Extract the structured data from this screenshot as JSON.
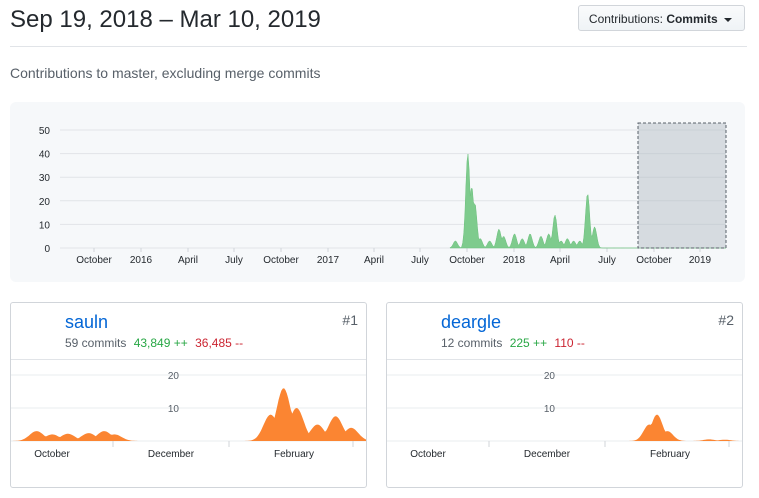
{
  "header": {
    "title": "Sep 19, 2018 – Mar 10, 2019",
    "select_prefix": "Contributions:",
    "select_value": "Commits"
  },
  "subtitle": "Contributions to master, excluding merge commits",
  "colors": {
    "main_fill": "#7ecb8d",
    "card_fill": "#fb8532",
    "link": "#0366d6",
    "added": "#28a745",
    "removed": "#cb2431"
  },
  "chart_data": [
    {
      "type": "area",
      "y_ticks": [
        "50",
        "40",
        "30",
        "20",
        "10",
        "0"
      ],
      "ylim": [
        0,
        50
      ],
      "x_tick_labels": [
        "October",
        "2016",
        "April",
        "July",
        "October",
        "2017",
        "April",
        "July",
        "October",
        "2018",
        "April",
        "July",
        "October",
        "2019"
      ],
      "series": [
        {
          "values": [
            [
              26.4,
              3
            ],
            [
              27.0,
              40
            ],
            [
              27.4,
              19
            ],
            [
              28.0,
              2
            ],
            [
              29.0,
              8
            ],
            [
              30.2,
              6
            ],
            [
              31.8,
              5
            ],
            [
              32.6,
              14
            ],
            [
              34.2,
              3
            ],
            [
              34.7,
              23
            ],
            [
              35.2,
              9
            ]
          ]
        }
      ],
      "selection": "Sep 19, 2018 – Mar 10, 2019"
    },
    {
      "type": "area",
      "y_ticks": [
        "20",
        "10"
      ],
      "x_tick_labels": [
        "October",
        "December",
        "February"
      ],
      "series": [
        {
          "values": [
            [
              0.3,
              3
            ],
            [
              0.9,
              2
            ],
            [
              1.6,
              3
            ],
            [
              5.0,
              16
            ],
            [
              6.0,
              7
            ]
          ]
        }
      ]
    },
    {
      "type": "area",
      "y_ticks": [
        "20",
        "10"
      ],
      "x_tick_labels": [
        "October",
        "December",
        "February"
      ],
      "series": [
        {
          "values": [
            [
              4.9,
              8
            ],
            [
              6.0,
              0.5
            ]
          ]
        }
      ]
    }
  ],
  "contributors": [
    {
      "name": "sauln",
      "commits": "59 commits",
      "added": "43,849 ++",
      "removed": "36,485 --",
      "rank": "#1"
    },
    {
      "name": "deargle",
      "commits": "12 commits",
      "added": "225 ++",
      "removed": "110 --",
      "rank": "#2"
    }
  ]
}
